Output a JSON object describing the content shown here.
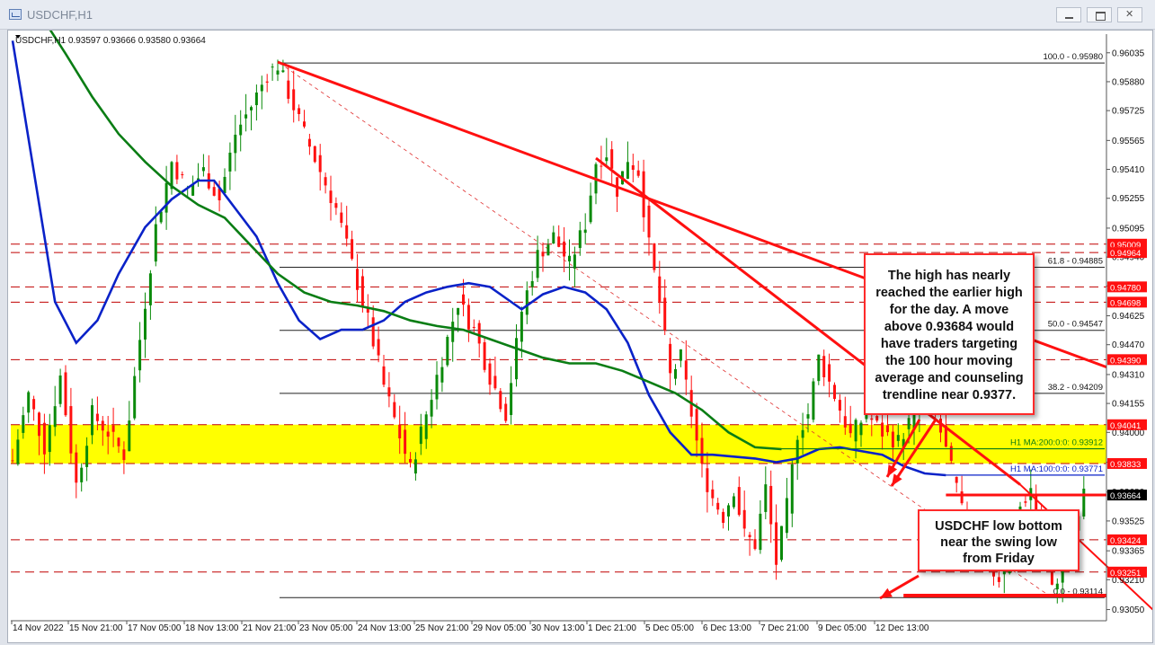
{
  "window": {
    "title": "USDCHF,H1",
    "icon": "chart-window-icon",
    "buttons": [
      "minimize-icon",
      "restore-icon",
      "close-icon"
    ]
  },
  "chart_data": {
    "type": "candlestick",
    "symbol": "USDCHF",
    "timeframe": "H1",
    "ohlc_header": "USDCHF,H1  0.93597 0.93666 0.93580 0.93664",
    "ylim": [
      0.9299,
      0.96135
    ],
    "grid": false,
    "y_ticks": [
      "0.96035",
      "0.95880",
      "0.95725",
      "0.95565",
      "0.95410",
      "0.95255",
      "0.95095",
      "0.94940",
      "0.94785",
      "0.94625",
      "0.94470",
      "0.94310",
      "0.94155",
      "0.94000",
      "0.93840",
      "0.93680",
      "0.93525",
      "0.93365",
      "0.93210",
      "0.93050"
    ],
    "x_ticks": [
      "14 Nov 2022",
      "15 Nov 21:00",
      "17 Nov 05:00",
      "18 Nov 13:00",
      "21 Nov 21:00",
      "23 Nov 05:00",
      "24 Nov 13:00",
      "25 Nov 21:00",
      "29 Nov 05:00",
      "30 Nov 13:00",
      "1 Dec 21:00",
      "5 Dec 05:00",
      "6 Dec 13:00",
      "7 Dec 21:00",
      "9 Dec 05:00",
      "12 Dec 13:00"
    ],
    "price_path": [
      [
        0,
        0.9385
      ],
      [
        3,
        0.942
      ],
      [
        6,
        0.9392
      ],
      [
        9,
        0.943
      ],
      [
        12,
        0.9372
      ],
      [
        15,
        0.941
      ],
      [
        18,
        0.94
      ],
      [
        21,
        0.9388
      ],
      [
        24,
        0.945
      ],
      [
        27,
        0.951
      ],
      [
        30,
        0.9545
      ],
      [
        33,
        0.953
      ],
      [
        36,
        0.954
      ],
      [
        39,
        0.9525
      ],
      [
        42,
        0.956
      ],
      [
        45,
        0.9575
      ],
      [
        48,
        0.9592
      ],
      [
        50,
        0.9597
      ],
      [
        52,
        0.9582
      ],
      [
        55,
        0.956
      ],
      [
        58,
        0.954
      ],
      [
        61,
        0.952
      ],
      [
        64,
        0.949
      ],
      [
        67,
        0.946
      ],
      [
        70,
        0.9425
      ],
      [
        73,
        0.9398
      ],
      [
        75,
        0.938
      ],
      [
        78,
        0.941
      ],
      [
        81,
        0.944
      ],
      [
        84,
        0.947
      ],
      [
        87,
        0.9455
      ],
      [
        90,
        0.943
      ],
      [
        93,
        0.941
      ],
      [
        96,
        0.9465
      ],
      [
        99,
        0.9495
      ],
      [
        102,
        0.9505
      ],
      [
        105,
        0.949
      ],
      [
        108,
        0.9512
      ],
      [
        110,
        0.9545
      ],
      [
        112,
        0.955
      ],
      [
        114,
        0.953
      ],
      [
        116,
        0.9547
      ],
      [
        118,
        0.954
      ],
      [
        120,
        0.95
      ],
      [
        122,
        0.947
      ],
      [
        124,
        0.943
      ],
      [
        126,
        0.944
      ],
      [
        128,
        0.941
      ],
      [
        130,
        0.938
      ],
      [
        132,
        0.9365
      ],
      [
        134,
        0.9355
      ],
      [
        136,
        0.937
      ],
      [
        138,
        0.9345
      ],
      [
        140,
        0.934
      ],
      [
        142,
        0.937
      ],
      [
        144,
        0.933
      ],
      [
        146,
        0.936
      ],
      [
        148,
        0.94
      ],
      [
        150,
        0.941
      ],
      [
        152,
        0.944
      ],
      [
        155,
        0.942
      ],
      [
        158,
        0.9398
      ],
      [
        161,
        0.941
      ],
      [
        164,
        0.94
      ],
      [
        167,
        0.9395
      ],
      [
        170,
        0.941
      ],
      [
        172,
        0.942
      ],
      [
        174,
        0.941
      ],
      [
        176,
        0.939
      ],
      [
        178,
        0.937
      ],
      [
        180,
        0.9345
      ],
      [
        182,
        0.9345
      ],
      [
        184,
        0.933
      ],
      [
        186,
        0.932
      ],
      [
        188,
        0.9335
      ],
      [
        190,
        0.936
      ],
      [
        192,
        0.937
      ],
      [
        194,
        0.9345
      ],
      [
        196,
        0.9315
      ],
      [
        198,
        0.933
      ],
      [
        200,
        0.9345
      ],
      [
        202,
        0.9366
      ]
    ],
    "moving_averages": [
      {
        "name": "H1 MA:100:0:0",
        "value": "0.93771",
        "color": "#0a22c8",
        "path": [
          [
            0,
            0.961
          ],
          [
            4,
            0.954
          ],
          [
            8,
            0.947
          ],
          [
            12,
            0.9448
          ],
          [
            16,
            0.946
          ],
          [
            20,
            0.9485
          ],
          [
            25,
            0.951
          ],
          [
            30,
            0.9525
          ],
          [
            35,
            0.9535
          ],
          [
            38,
            0.9535
          ],
          [
            42,
            0.952
          ],
          [
            46,
            0.9505
          ],
          [
            50,
            0.948
          ],
          [
            54,
            0.946
          ],
          [
            58,
            0.945
          ],
          [
            62,
            0.9455
          ],
          [
            66,
            0.9455
          ],
          [
            70,
            0.946
          ],
          [
            74,
            0.947
          ],
          [
            78,
            0.9475
          ],
          [
            82,
            0.9478
          ],
          [
            86,
            0.948
          ],
          [
            90,
            0.9478
          ],
          [
            94,
            0.947
          ],
          [
            96,
            0.9466
          ],
          [
            100,
            0.9474
          ],
          [
            104,
            0.9478
          ],
          [
            108,
            0.9475
          ],
          [
            112,
            0.9466
          ],
          [
            116,
            0.9448
          ],
          [
            120,
            0.942
          ],
          [
            124,
            0.94
          ],
          [
            128,
            0.9388
          ],
          [
            132,
            0.9388
          ],
          [
            136,
            0.9387
          ],
          [
            140,
            0.9386
          ],
          [
            144,
            0.9384
          ],
          [
            148,
            0.9386
          ],
          [
            152,
            0.9391
          ],
          [
            156,
            0.9392
          ],
          [
            160,
            0.939
          ],
          [
            164,
            0.9388
          ],
          [
            168,
            0.9382
          ],
          [
            172,
            0.9378
          ],
          [
            176,
            0.9377
          ]
        ]
      },
      {
        "name": "H1 MA:200:0:0",
        "value": "0.93912",
        "color": "#0a7d14",
        "path": [
          [
            0,
            0.9642
          ],
          [
            5,
            0.9625
          ],
          [
            10,
            0.9603
          ],
          [
            15,
            0.958
          ],
          [
            20,
            0.956
          ],
          [
            25,
            0.9545
          ],
          [
            30,
            0.9532
          ],
          [
            35,
            0.9522
          ],
          [
            40,
            0.9515
          ],
          [
            45,
            0.95
          ],
          [
            50,
            0.9485
          ],
          [
            55,
            0.9475
          ],
          [
            60,
            0.947
          ],
          [
            65,
            0.9468
          ],
          [
            70,
            0.9465
          ],
          [
            75,
            0.946
          ],
          [
            80,
            0.9457
          ],
          [
            85,
            0.9455
          ],
          [
            90,
            0.945
          ],
          [
            95,
            0.9445
          ],
          [
            100,
            0.944
          ],
          [
            105,
            0.9437
          ],
          [
            110,
            0.9437
          ],
          [
            115,
            0.9433
          ],
          [
            120,
            0.9427
          ],
          [
            125,
            0.9421
          ],
          [
            130,
            0.9412
          ],
          [
            135,
            0.94
          ],
          [
            140,
            0.9392
          ],
          [
            145,
            0.9391
          ]
        ]
      }
    ],
    "fibonacci": [
      {
        "label": "100.0 - 0.95980",
        "value": 0.9598
      },
      {
        "label": "61.8 - 0.94885",
        "value": 0.94885
      },
      {
        "label": "50.0 - 0.94547",
        "value": 0.94547
      },
      {
        "label": "38.2 - 0.94209",
        "value": 0.94209
      },
      {
        "label": "0.0 - 0.93114",
        "value": 0.93114
      }
    ],
    "horizontal_levels": [
      {
        "label": "0.95009",
        "value": 0.95009,
        "style": "dashed"
      },
      {
        "label": "0.94964",
        "value": 0.94964,
        "style": "dashed"
      },
      {
        "label": "0.94780",
        "value": 0.9478,
        "style": "dashed"
      },
      {
        "label": "0.94698",
        "value": 0.94698,
        "style": "dashed"
      },
      {
        "label": "0.94390",
        "value": 0.9439,
        "style": "dashed"
      },
      {
        "label": "0.94041",
        "value": 0.94041,
        "style": "dashed"
      },
      {
        "label": "0.93833",
        "value": 0.93833,
        "style": "dashed"
      },
      {
        "label": "0.93424",
        "value": 0.93424,
        "style": "dashed"
      },
      {
        "label": "0.93251",
        "value": 0.93251,
        "style": "dashed"
      }
    ],
    "current_price": {
      "label": "0.93664",
      "value": 0.93664
    },
    "support_zone": {
      "from": 0.93833,
      "to": 0.94041,
      "color": "#ffff00"
    },
    "colors": {
      "trendline": "#ff1010",
      "up_candle": "#0a8a0a",
      "down_candle": "#ff1010",
      "axis_text": "#111111"
    }
  },
  "annotations": {
    "high_note": "The high has nearly reached the earlier high for the day.  A move above  0.93684 would have traders targeting the 100 hour moving average and counseling trendline near 0.9377.",
    "low_note": "USDCHF low bottom near the swing low from Friday"
  }
}
